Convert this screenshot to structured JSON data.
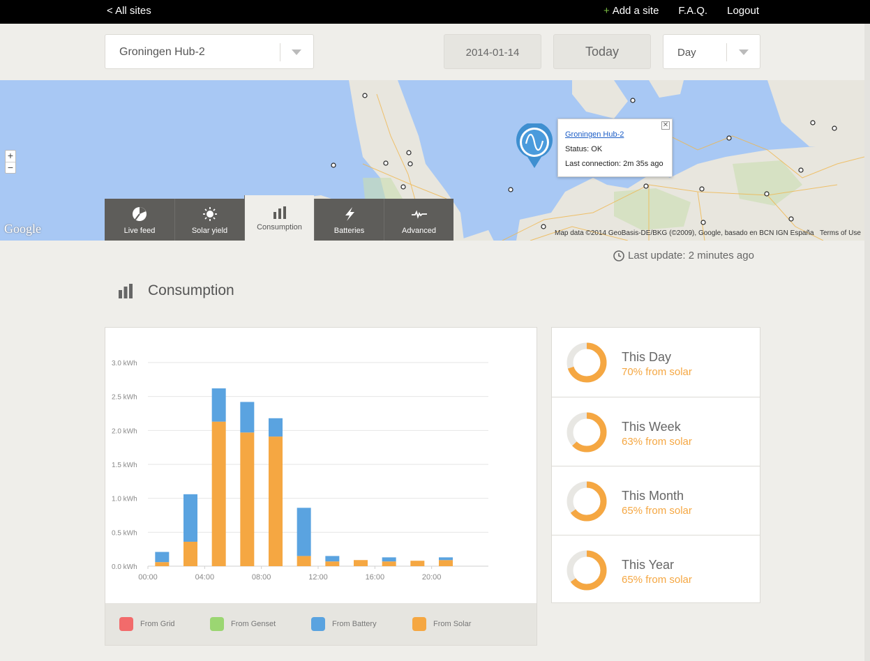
{
  "topbar": {
    "all_sites": "< All sites",
    "add_site": "Add a site",
    "faq": "F.A.Q.",
    "logout": "Logout"
  },
  "controls": {
    "site": "Groningen Hub-2",
    "date": "2014-01-14",
    "today": "Today",
    "period": "Day"
  },
  "map": {
    "zoom_in": "+",
    "zoom_out": "−",
    "logo": "Google",
    "attribution": "Map data ©2014 GeoBasis-DE/BKG (©2009), Google, basado en BCN IGN España",
    "terms": "Terms of Use",
    "popup": {
      "site_link": "Groningen Hub-2",
      "status": "Status: OK",
      "last_connection": "Last connection: 2m 35s ago",
      "close": "✕"
    }
  },
  "tabs": [
    {
      "label": "Live feed",
      "icon": "pie-chart-icon",
      "active": false
    },
    {
      "label": "Solar yield",
      "icon": "sun-icon",
      "active": false
    },
    {
      "label": "Consumption",
      "icon": "bar-chart-icon",
      "active": true
    },
    {
      "label": "Batteries",
      "icon": "lightning-icon",
      "active": false
    },
    {
      "label": "Advanced",
      "icon": "waveform-icon",
      "active": false
    }
  ],
  "last_update": "Last update: 2 minutes ago",
  "section_title": "Consumption",
  "colors": {
    "grid": "#f26b6b",
    "genset": "#9bd672",
    "battery": "#5aa3e0",
    "solar": "#f5a742"
  },
  "chart_data": {
    "type": "bar",
    "stacked": true,
    "x_ticks": [
      "00:00",
      "04:00",
      "08:00",
      "12:00",
      "16:00",
      "20:00"
    ],
    "categories": [
      "00:00",
      "02:00",
      "04:00",
      "06:00",
      "08:00",
      "10:00",
      "12:00",
      "14:00",
      "16:00",
      "18:00",
      "20:00",
      "22:00"
    ],
    "y_ticks": [
      "0.0 kWh",
      "0.5 kWh",
      "1.0 kWh",
      "1.5 kWh",
      "2.0 kWh",
      "2.5 kWh",
      "3.0 kWh"
    ],
    "ylim": [
      0,
      3.0
    ],
    "series": [
      {
        "name": "From Grid",
        "values": [
          0,
          0,
          0,
          0,
          0,
          0,
          0,
          0,
          0,
          0,
          0,
          0
        ]
      },
      {
        "name": "From Genset",
        "values": [
          0,
          0,
          0,
          0,
          0,
          0,
          0,
          0,
          0,
          0,
          0,
          0
        ]
      },
      {
        "name": "From Solar",
        "values": [
          0.06,
          0.36,
          2.13,
          1.97,
          1.91,
          0.15,
          0.07,
          0.09,
          0.07,
          0.08,
          0.09,
          0
        ]
      },
      {
        "name": "From Battery",
        "values": [
          0.15,
          0.7,
          0.49,
          0.45,
          0.27,
          0.71,
          0.08,
          0,
          0.06,
          0,
          0.04,
          0
        ]
      }
    ],
    "legend": [
      "From Grid",
      "From Genset",
      "From Battery",
      "From Solar"
    ]
  },
  "stats": [
    {
      "name": "This Day",
      "pct_label": "70% from solar",
      "solar_fraction": 0.7
    },
    {
      "name": "This Week",
      "pct_label": "63% from solar",
      "solar_fraction": 0.63
    },
    {
      "name": "This Month",
      "pct_label": "65% from solar",
      "solar_fraction": 0.65
    },
    {
      "name": "This Year",
      "pct_label": "65% from solar",
      "solar_fraction": 0.65
    }
  ]
}
